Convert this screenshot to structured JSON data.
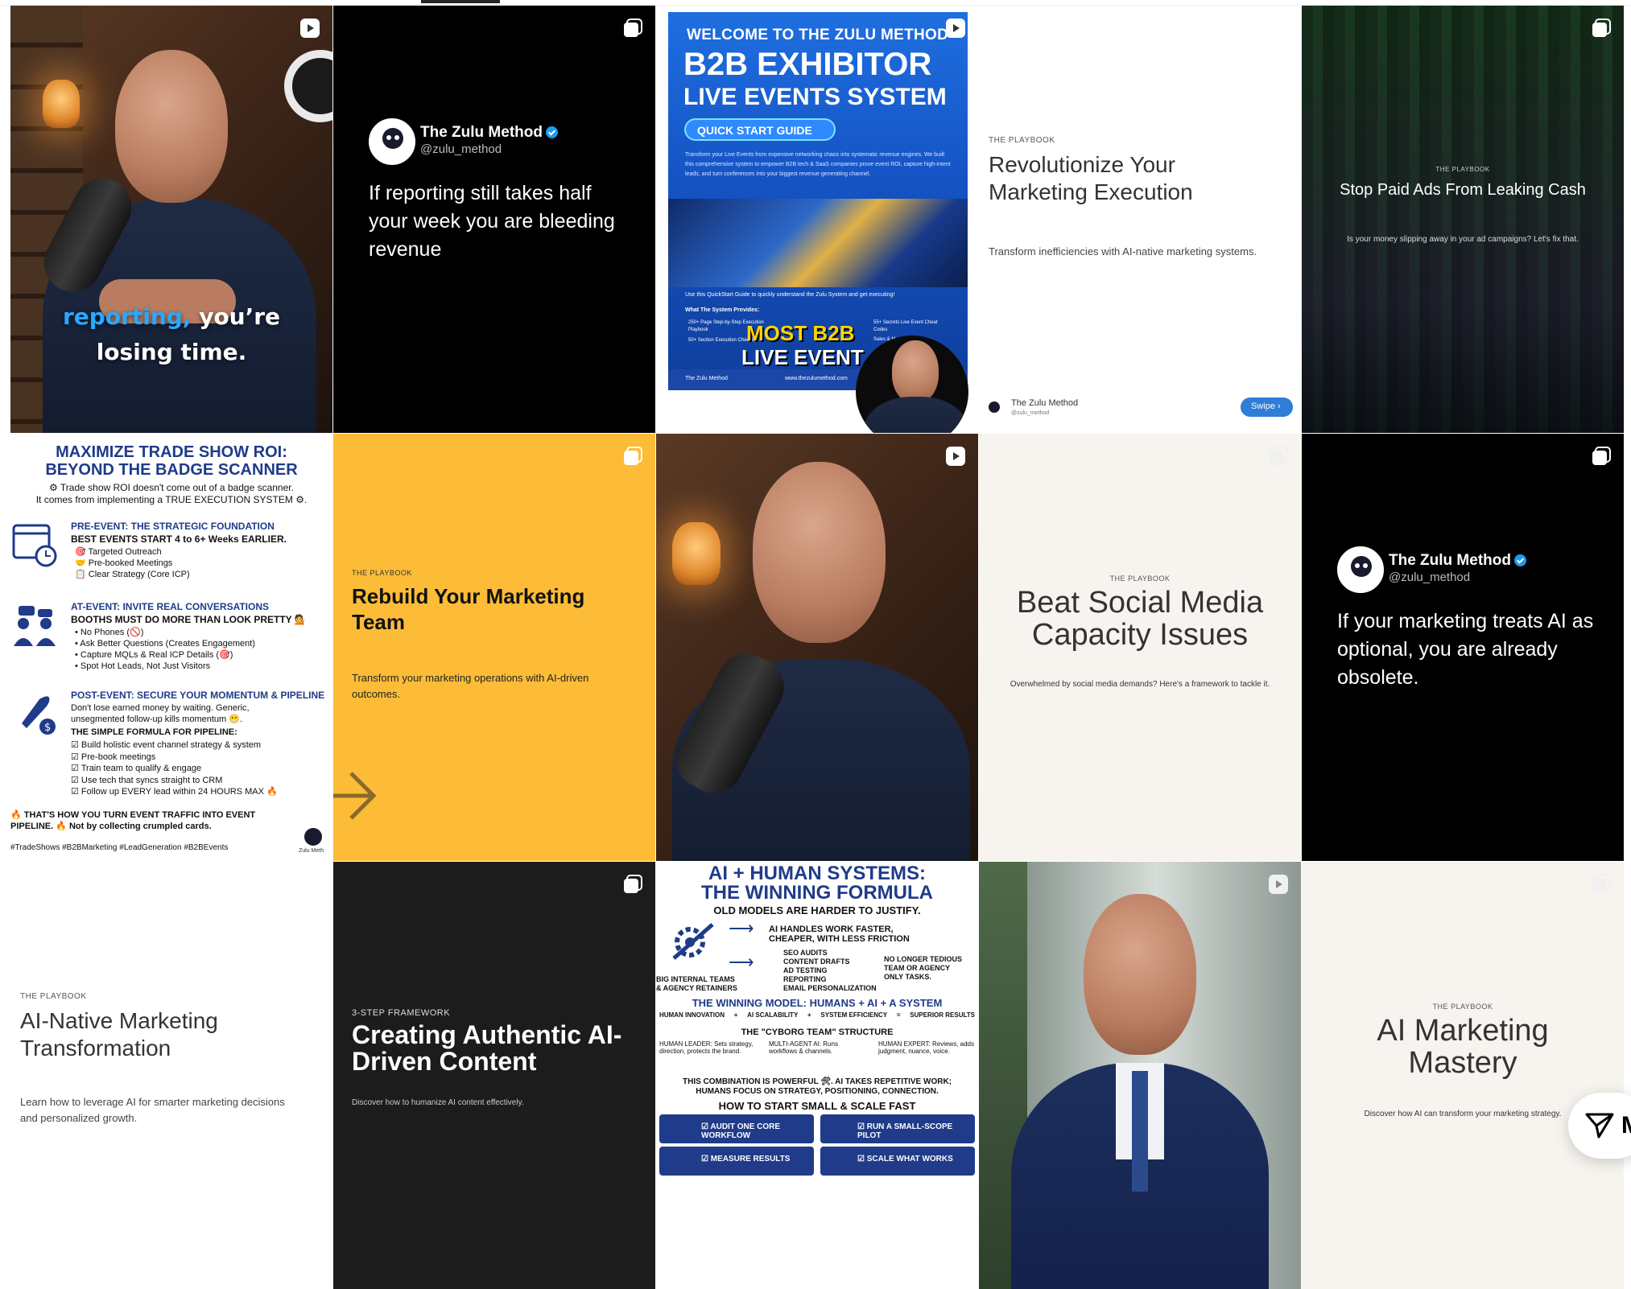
{
  "dm": {
    "label": "M"
  },
  "tiles": {
    "t1": {
      "caption_blue": "reporting,",
      "caption_white1": "you’re",
      "caption_white2": "losing time."
    },
    "t2": {
      "name": "The Zulu Method",
      "handle": "@zulu_method",
      "text": "If reporting still takes half your week you are bleeding revenue"
    },
    "t3": {
      "welcome": "WELCOME TO THE ZULU METHOD",
      "title1": "B2B EXHIBITOR",
      "title2": "LIVE EVENTS SYSTEM",
      "button": "QUICK START GUIDE",
      "desc": "Transform your Live Events from expensive networking chaos into systematic revenue engines. We built this comprehensive system to empower B2B tech & SaaS companies prove event ROI, capture high-intent leads, and turn conferences into your biggest revenue generating channel.",
      "use": "Use this QuickStart Guide to quickly understand the Zulu System and get executing!",
      "provides": "What The System Provides:",
      "item1": "250+ Page Step-by-Step Execution Playbook",
      "item2": "50+ Section Execution Checklist",
      "item3": "55+ Secrets Live Event Cheat Codes",
      "item4": "Sales & M",
      "overlay1": "MOST B2B",
      "overlay2": "LIVE EVENT",
      "footer_left": "The Zulu Method",
      "footer_url": "www.thezulumethod.com"
    },
    "t4": {
      "kicker": "THE PLAYBOOK",
      "title": "Revolutionize Your Marketing Execution",
      "body": "Transform inefficiencies with AI-native marketing systems.",
      "author": "The Zulu Method",
      "handle": "@zulu_method",
      "swipe": "Swipe"
    },
    "t5": {
      "kicker": "THE PLAYBOOK",
      "title": "Stop Paid Ads From Leaking Cash",
      "body": "Is your money slipping away in your ad campaigns? Let's fix that."
    },
    "t6": {
      "title1": "MAXIMIZE TRADE SHOW ROI:",
      "title2": "BEYOND THE BADGE SCANNER",
      "intro1": "⚙ Trade show ROI doesn't come out of a badge scanner.",
      "intro2": "It comes from implementing a TRUE EXECUTION SYSTEM ⚙.",
      "pre_h": "PRE-EVENT: THE STRATEGIC FOUNDATION",
      "pre_sub": "BEST EVENTS START 4 to 6+ Weeks EARLIER.",
      "pre_items": [
        "🎯 Targeted Outreach",
        "🤝 Pre-booked Meetings",
        "📋 Clear Strategy (Core ICP)"
      ],
      "at_h": "AT-EVENT: INVITE REAL CONVERSATIONS",
      "at_sub": "BOOTHS MUST DO MORE THAN LOOK PRETTY 💁",
      "at_items": [
        "• No Phones (🚫)",
        "• Ask Better Questions (Creates Engagement)",
        "• Capture MQLs & Real ICP Details (🎯)",
        "• Spot Hot Leads, Not Just Visitors"
      ],
      "post_h": "POST-EVENT: SECURE YOUR MOMENTUM & PIPELINE",
      "post_sub1": "Don't lose earned money by waiting. Generic,",
      "post_sub2": "unsegmented follow-up kills momentum 😬.",
      "formula": "THE SIMPLE FORMULA FOR PIPELINE:",
      "formula_items": [
        "☑ Build holistic event channel strategy & system",
        "☑ Pre-book meetings",
        "☑ Train team to qualify & engage",
        "☑ Use tech that syncs straight to CRM",
        "☑ Follow up EVERY lead within 24 HOURS MAX 🔥"
      ],
      "outro1": "🔥 THAT'S HOW YOU TURN EVENT TRAFFIC INTO EVENT",
      "outro2": "PIPELINE. 🔥 Not by collecting crumpled cards.",
      "tags": "#TradeShows #B2BMarketing #LeadGeneration #B2BEvents",
      "brand": "Zulu Meth"
    },
    "t7": {
      "kicker": "THE PLAYBOOK",
      "title": "Rebuild Your Marketing Team",
      "body": "Transform your marketing operations with AI-driven outcomes."
    },
    "t9": {
      "kicker": "THE PLAYBOOK",
      "title": "Beat Social Media Capacity Issues",
      "body": "Overwhelmed by social media demands? Here's a framework to tackle it."
    },
    "t10": {
      "name": "The Zulu Method",
      "handle": "@zulu_method",
      "text": "If your marketing treats AI as optional, you are already obsolete."
    },
    "t11": {
      "kicker": "THE PLAYBOOK",
      "title": "AI-Native Marketing Transformation",
      "body": "Learn how to leverage AI for smarter marketing decisions and personalized growth."
    },
    "t12": {
      "kicker": "3-STEP FRAMEWORK",
      "title": "Creating Authentic AI-Driven Content",
      "body": "Discover how to humanize AI content effectively."
    },
    "t13": {
      "title1": "AI + HUMAN SYSTEMS:",
      "title2": "THE WINNING FORMULA",
      "sub": "OLD MODELS ARE HARDER TO JUSTIFY.",
      "ai_handles1": "AI HANDLES WORK FASTER,",
      "ai_handles2": "CHEAPER, WITH LESS FRICTION",
      "tasks": [
        "SEO AUDITS",
        "CONTENT DRAFTS",
        "AD TESTING",
        "REPORTING",
        "EMAIL PERSONALIZATION"
      ],
      "left1": "BIG INTERNAL TEAMS",
      "left2": "& AGENCY RETAINERS",
      "right1": "NO LONGER TEDIOUS",
      "right2": "TEAM OR AGENCY",
      "right3": "ONLY TASKS.",
      "model": "THE WINNING MODEL: HUMANS + AI + A SYSTEM",
      "eq": [
        "HUMAN INNOVATION",
        "AI SCALABILITY",
        "SYSTEM EFFICIENCY",
        "SUPERIOR RESULTS"
      ],
      "cyborg": "THE \"CYBORG TEAM\" STRUCTURE",
      "roles": [
        "HUMAN LEADER: Sets strategy, direction, protects the brand.",
        "MULTI-AGENT AI: Runs workflows & channels.",
        "HUMAN EXPERT: Reviews, adds judgment, nuance, voice."
      ],
      "combo1": "THIS COMBINATION IS POWERFUL 🛠. AI TAKES REPETITIVE WORK;",
      "combo2": "HUMANS FOCUS ON STRATEGY, POSITIONING, CONNECTION.",
      "start": "HOW TO START SMALL & SCALE FAST",
      "steps": [
        "☑ AUDIT ONE CORE WORKFLOW",
        "☑ RUN A SMALL-SCOPE PILOT",
        "☑ MEASURE RESULTS",
        "☑ SCALE WHAT WORKS"
      ]
    },
    "t15": {
      "kicker": "THE PLAYBOOK",
      "title": "AI Marketing Mastery",
      "body": "Discover how AI can transform your marketing strategy."
    }
  }
}
